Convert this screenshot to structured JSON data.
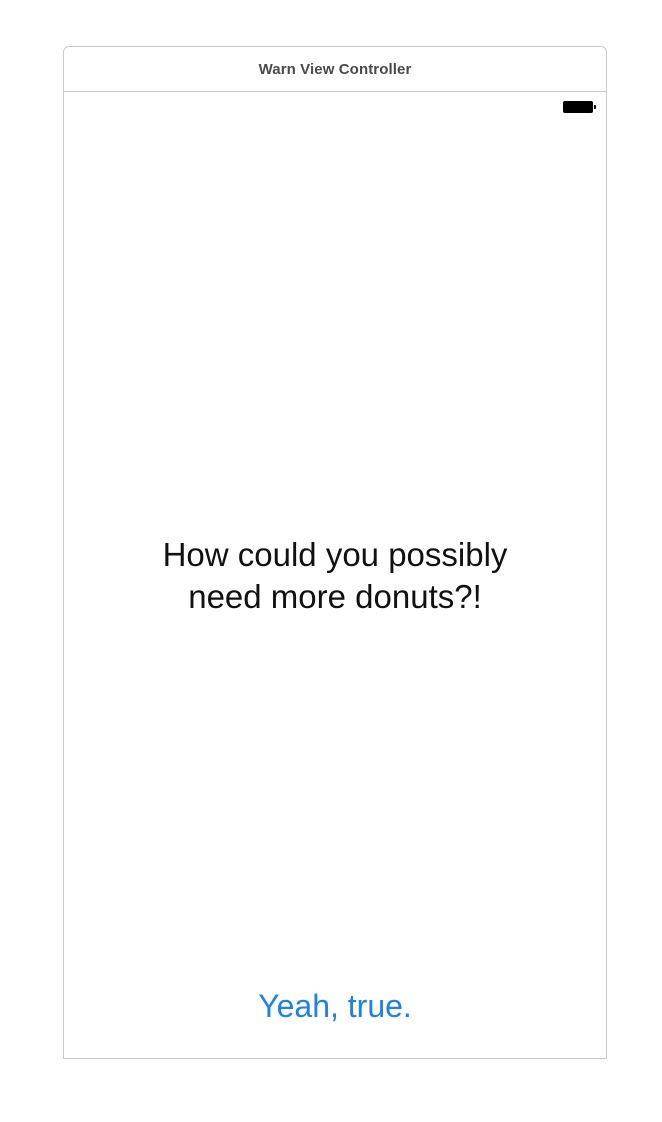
{
  "scene": {
    "title": "Warn View Controller"
  },
  "status_bar": {
    "battery_icon": "battery-full-icon"
  },
  "message": {
    "line1": "How could you possibly",
    "line2": "need more donuts?!"
  },
  "confirm_button": {
    "label": "Yeah, true."
  },
  "colors": {
    "button_tint": "#1a82e8",
    "label_text": "#111111",
    "frame_border": "#c8c8c8"
  }
}
